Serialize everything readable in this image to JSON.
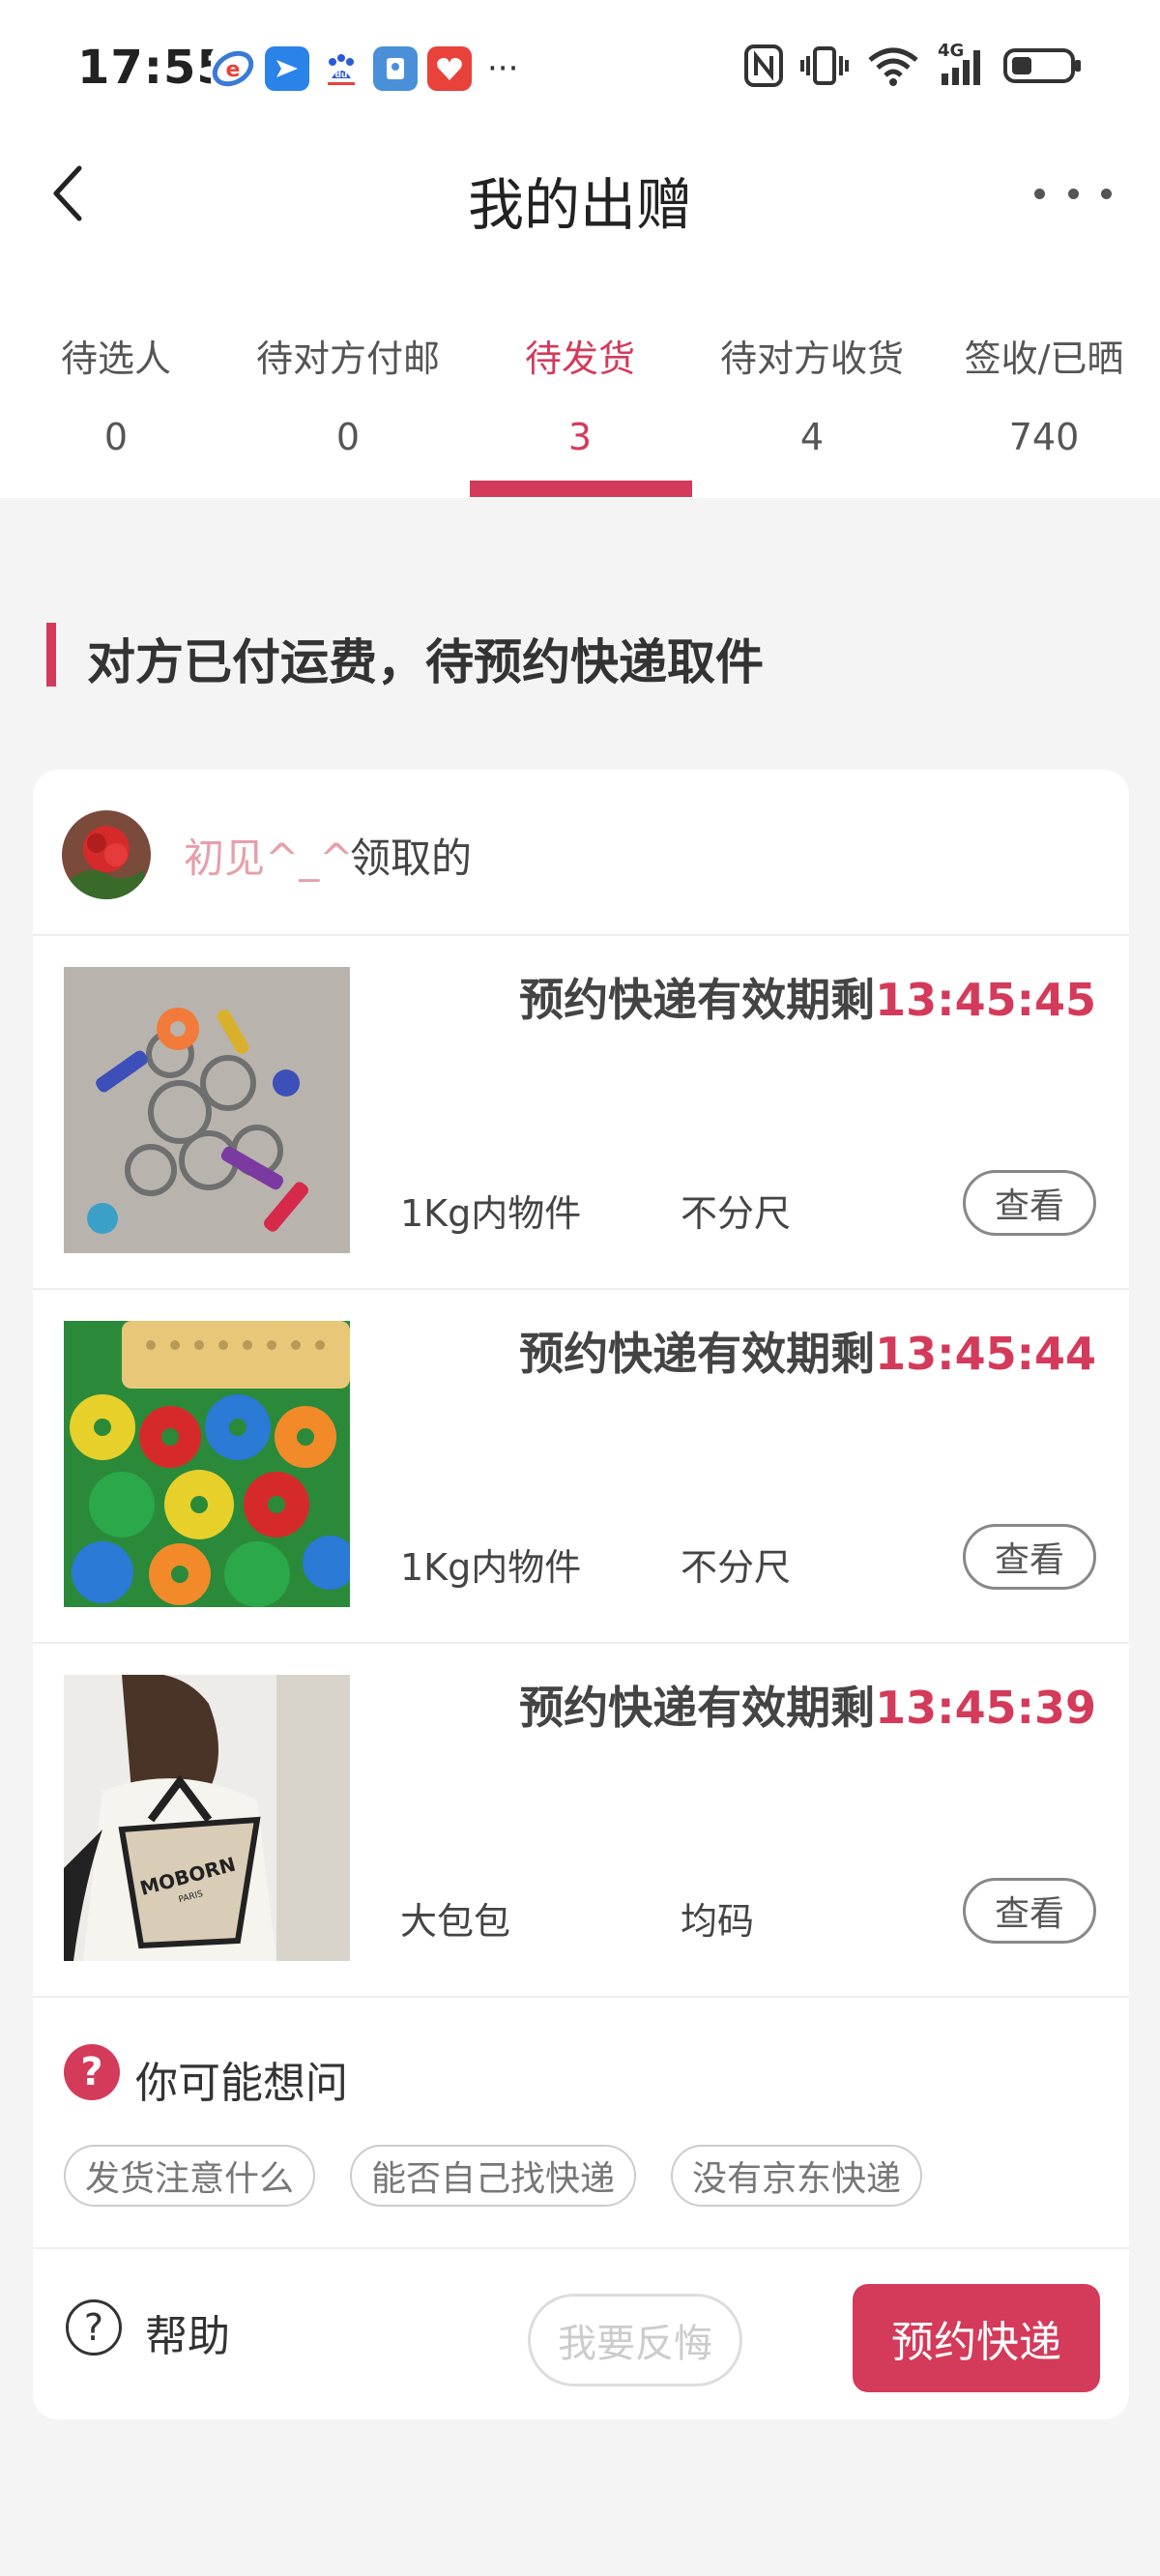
{
  "status_bar": {
    "time": "17:55",
    "more": "···",
    "network": "4G",
    "apps": [
      {
        "icon": "app-browser-icon",
        "color": "#3a7bd5",
        "glyph": "Ⓓ"
      },
      {
        "icon": "app-feishu-icon",
        "color": "#2a83e8",
        "glyph": "➤"
      },
      {
        "icon": "app-baidu-icon",
        "color": "#ffffff",
        "glyph": "du"
      },
      {
        "icon": "app-wallet-icon",
        "color": "#4a90d9",
        "glyph": "▣"
      },
      {
        "icon": "app-red-icon",
        "color": "#e8423a",
        "glyph": "❤"
      }
    ]
  },
  "header": {
    "title": "我的出赠"
  },
  "tabs": [
    {
      "label": "待选人",
      "count": "0"
    },
    {
      "label": "待对方付邮",
      "count": "0"
    },
    {
      "label": "待发货",
      "count": "3"
    },
    {
      "label": "待对方收货",
      "count": "4"
    },
    {
      "label": "签收/已晒",
      "count": "740"
    }
  ],
  "section": {
    "title": "对方已付运费，待预约快递取件"
  },
  "receiver": {
    "name": "初见^_^",
    "suffix": "领取的"
  },
  "items": [
    {
      "deadline_label": "预约快递有效期剩",
      "countdown": "13:45:45",
      "name": "1Kg内物件",
      "size": "不分尺",
      "view_label": "查看"
    },
    {
      "deadline_label": "预约快递有效期剩",
      "countdown": "13:45:44",
      "name": "1Kg内物件",
      "size": "不分尺",
      "view_label": "查看"
    },
    {
      "deadline_label": "预约快递有效期剩",
      "countdown": "13:45:39",
      "name": "大包包",
      "size": "均码",
      "view_label": "查看"
    }
  ],
  "faq": {
    "title": "你可能想问",
    "chips": [
      "发货注意什么",
      "能否自己找快递",
      "没有京东快递"
    ]
  },
  "footer": {
    "help_label": "帮助",
    "regret_label": "我要反悔",
    "book_label": "预约快递"
  },
  "bag_print": {
    "brand": "MOBORN",
    "sub": "PARIS"
  },
  "colors": {
    "accent": "#d43a5a",
    "receiver_name": "#e6a0ab",
    "page_bg": "#f4f4f4"
  }
}
